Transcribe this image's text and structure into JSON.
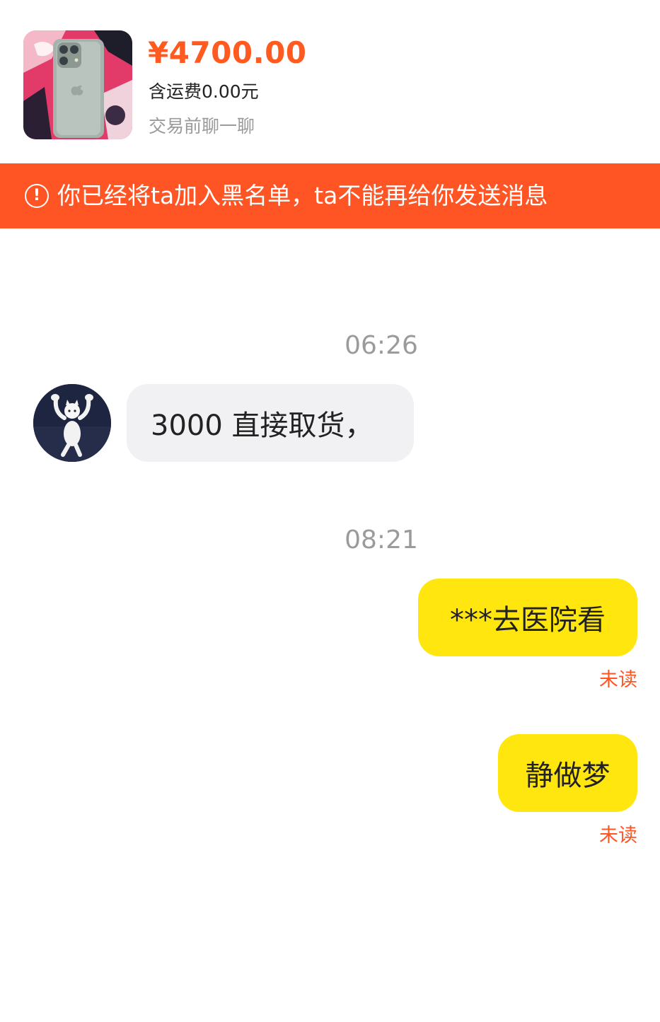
{
  "product": {
    "price": "¥4700.00",
    "shipping": "含运费0.00元",
    "hint": "交易前聊一聊"
  },
  "banner": {
    "icon": "alert-circle-icon",
    "text": "你已经将ta加入黑名单，ta不能再给你发送消息"
  },
  "chat": {
    "timestamps": [
      "06:26",
      "08:21"
    ],
    "messages": [
      {
        "direction": "incoming",
        "text": "3000 直接取货，"
      },
      {
        "direction": "outgoing",
        "text": "***去医院看",
        "status": "未读"
      },
      {
        "direction": "outgoing",
        "text": "静做梦",
        "status": "未读"
      }
    ]
  },
  "colors": {
    "accent": "#ff5524",
    "price": "#ff5a1f",
    "outgoing_bubble": "#ffe60f",
    "incoming_bubble": "#f1f1f3"
  }
}
